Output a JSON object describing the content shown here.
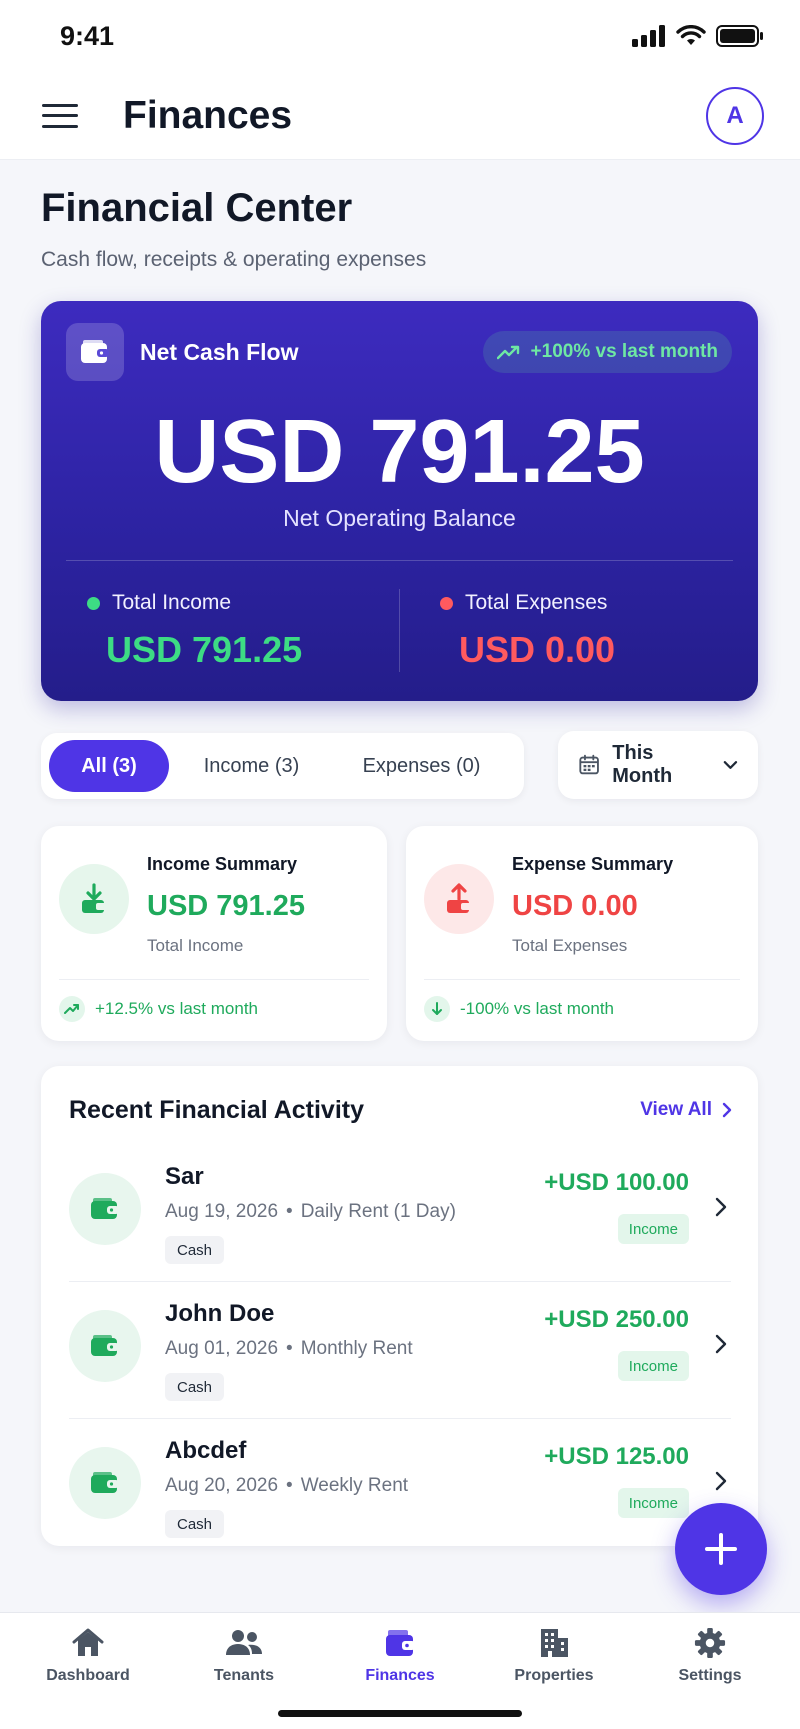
{
  "status_bar": {
    "time": "9:41"
  },
  "header": {
    "title": "Finances",
    "avatar_initial": "A"
  },
  "page": {
    "title": "Financial Center",
    "subtitle": "Cash flow, receipts & operating expenses"
  },
  "balance_card": {
    "label": "Net Cash Flow",
    "trend": "+100% vs last month",
    "amount": "USD 791.25",
    "caption": "Net Operating Balance",
    "income_label": "Total Income",
    "income_value": "USD 791.25",
    "expense_label": "Total Expenses",
    "expense_value": "USD 0.00"
  },
  "filters": {
    "tabs": [
      {
        "label": "All (3)",
        "active": true
      },
      {
        "label": "Income (3)",
        "active": false
      },
      {
        "label": "Expenses (0)",
        "active": false
      }
    ],
    "period": "This Month"
  },
  "summary": {
    "income": {
      "title": "Income Summary",
      "value": "USD 791.25",
      "caption": "Total Income",
      "trend": "+12.5% vs last month"
    },
    "expense": {
      "title": "Expense Summary",
      "value": "USD 0.00",
      "caption": "Total Expenses",
      "trend": "-100% vs last month"
    }
  },
  "activity": {
    "title": "Recent Financial Activity",
    "view_all": "View All",
    "items": [
      {
        "name": "Sar",
        "date": "Aug 19, 2026",
        "separator": "•",
        "description": "Daily Rent (1 Day)",
        "method": "Cash",
        "amount": "+USD 100.00",
        "type": "Income"
      },
      {
        "name": "John Doe",
        "date": "Aug 01, 2026",
        "separator": "•",
        "description": "Monthly Rent",
        "method": "Cash",
        "amount": "+USD 250.00",
        "type": "Income"
      },
      {
        "name": "Abcdef",
        "date": "Aug 20, 2026",
        "separator": "•",
        "description": "Weekly Rent",
        "method": "Cash",
        "amount": "+USD 125.00",
        "type": "Income"
      }
    ]
  },
  "nav": {
    "items": [
      {
        "label": "Dashboard",
        "icon": "home-icon"
      },
      {
        "label": "Tenants",
        "icon": "users-icon"
      },
      {
        "label": "Finances",
        "icon": "wallet-icon",
        "active": true
      },
      {
        "label": "Properties",
        "icon": "building-icon"
      },
      {
        "label": "Settings",
        "icon": "gear-icon"
      }
    ]
  },
  "colors": {
    "primary": "#4f35e6",
    "income_green": "#1faa5c",
    "expense_red": "#ef4444",
    "card_green": "#3ddc84",
    "card_red": "#ff5a5f"
  }
}
